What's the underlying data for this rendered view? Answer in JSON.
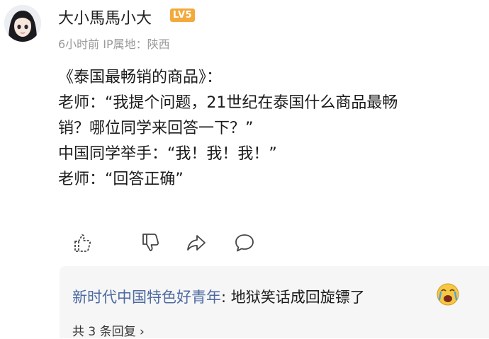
{
  "user": {
    "name": "大小馬馬小大",
    "badge": "LV5",
    "meta": "6小时前 IP属地：陕西"
  },
  "post": {
    "lines": [
      "《泰国最畅销的商品》：",
      "老师：“我提个问题，21世纪在泰国什么商品最畅",
      "销？哪位同学来回答一下？”",
      "中国同学举手：“我！我！我！”",
      "老师：“回答正确”"
    ]
  },
  "actions": [
    {
      "icon": "thumbs-up-icon"
    },
    {
      "icon": "thumbs-down-icon"
    },
    {
      "icon": "share-icon"
    },
    {
      "icon": "comment-icon"
    }
  ],
  "reply": {
    "user": "新时代中国特色好青年",
    "separator": ": ",
    "text": "地狱笑话成回旋镖了",
    "emoji": "crying-face-icon",
    "count_label": "共 3 条回复 ›"
  },
  "colors": {
    "badge": "#f3a93b",
    "reply_user": "#4d6aa0",
    "meta": "#9a9a9a",
    "comment_bg": "#f6f6f7"
  }
}
